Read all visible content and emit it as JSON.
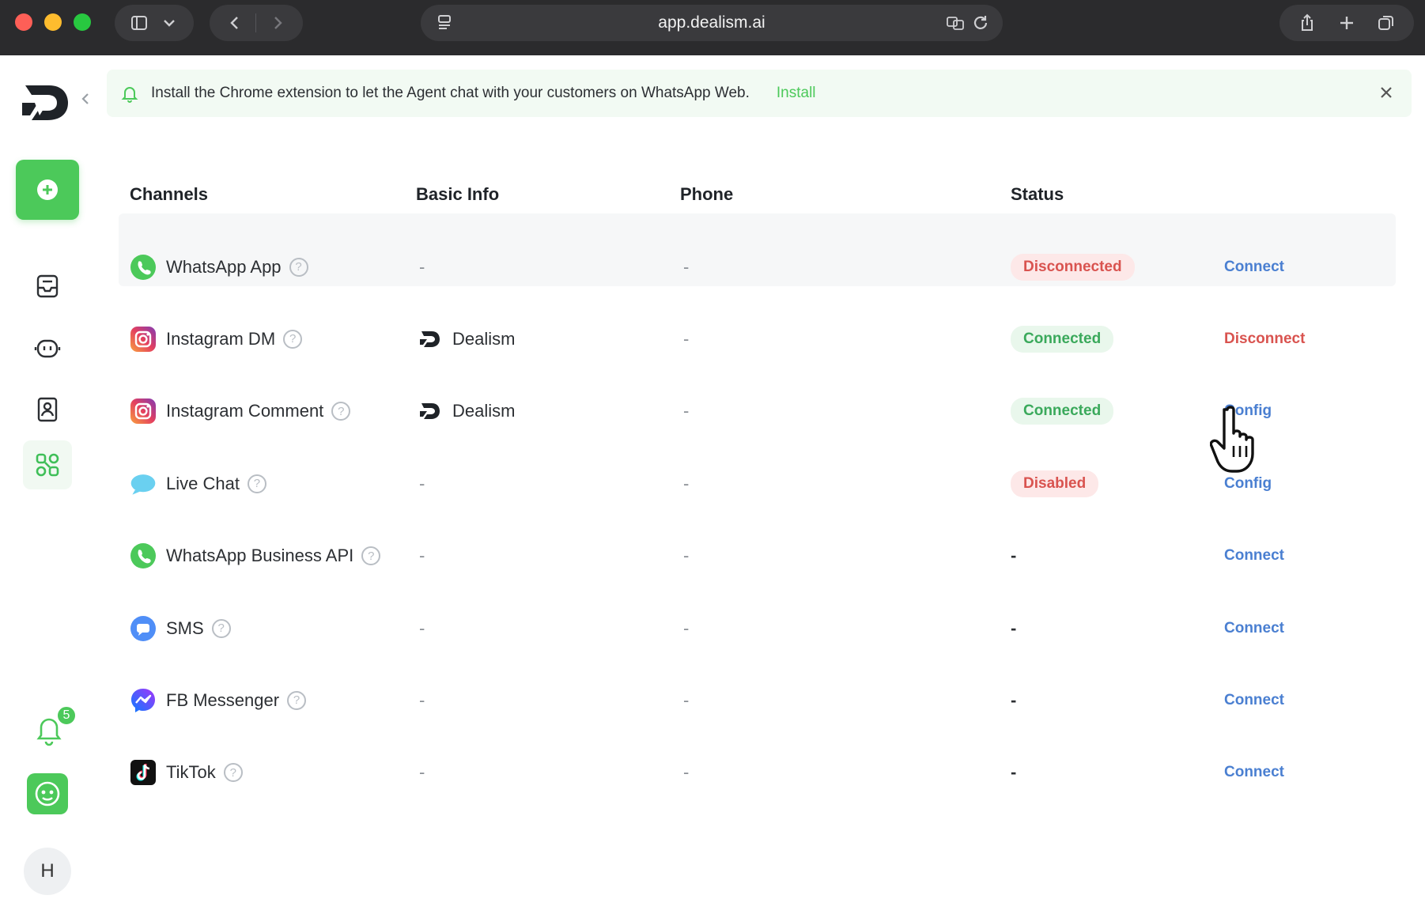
{
  "browser": {
    "url": "app.dealism.ai"
  },
  "banner": {
    "text": "Install the Chrome extension to let the Agent chat with your customers on WhatsApp Web.",
    "link": "Install"
  },
  "sidebar": {
    "notification_count": "5",
    "avatar_initial": "H"
  },
  "table": {
    "headers": [
      "Channels",
      "Basic Info",
      "Phone",
      "Status"
    ],
    "rows": [
      {
        "channel": "WhatsApp App",
        "icon": "whatsapp-icon",
        "basic_info": "-",
        "phone": "-",
        "status": "Disconnected",
        "status_type": "bad",
        "action": "Connect",
        "action_type": "blue"
      },
      {
        "channel": "Instagram DM",
        "icon": "instagram-icon",
        "basic_info": "Dealism",
        "phone": "-",
        "status": "Connected",
        "status_type": "good",
        "action": "Disconnect",
        "action_type": "red"
      },
      {
        "channel": "Instagram Comment",
        "icon": "instagram-icon",
        "basic_info": "Dealism",
        "phone": "-",
        "status": "Connected",
        "status_type": "good",
        "action": "Config",
        "action_type": "blue"
      },
      {
        "channel": "Live Chat",
        "icon": "live-chat-icon",
        "basic_info": "-",
        "phone": "-",
        "status": "Disabled",
        "status_type": "bad",
        "action": "Config",
        "action_type": "blue"
      },
      {
        "channel": "WhatsApp Business API",
        "icon": "whatsapp-icon",
        "basic_info": "-",
        "phone": "-",
        "status": "-",
        "status_type": "none",
        "action": "Connect",
        "action_type": "blue"
      },
      {
        "channel": "SMS",
        "icon": "sms-icon",
        "basic_info": "-",
        "phone": "-",
        "status": "-",
        "status_type": "none",
        "action": "Connect",
        "action_type": "blue"
      },
      {
        "channel": "FB Messenger",
        "icon": "messenger-icon",
        "basic_info": "-",
        "phone": "-",
        "status": "-",
        "status_type": "none",
        "action": "Connect",
        "action_type": "blue"
      },
      {
        "channel": "TikTok",
        "icon": "tiktok-icon",
        "basic_info": "-",
        "phone": "-",
        "status": "-",
        "status_type": "none",
        "action": "Connect",
        "action_type": "blue"
      }
    ]
  },
  "colors": {
    "brand_green": "#4cc95a",
    "link_blue": "#4a7fd1",
    "danger_red": "#d9534f"
  }
}
